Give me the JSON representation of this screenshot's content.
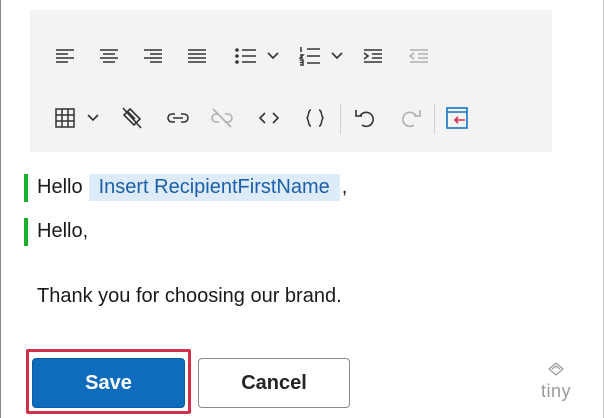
{
  "toolbar": {
    "row1": [
      {
        "icon": "align-left-icon"
      },
      {
        "icon": "align-center-icon"
      },
      {
        "icon": "align-right-icon"
      },
      {
        "icon": "align-justify-icon"
      },
      {
        "icon": "bullet-list-icon"
      },
      {
        "icon": "chevron-down-icon"
      },
      {
        "icon": "numbered-list-icon"
      },
      {
        "icon": "chevron-down-icon"
      },
      {
        "icon": "indent-icon"
      },
      {
        "icon": "outdent-icon"
      }
    ],
    "row2": [
      {
        "icon": "table-icon"
      },
      {
        "icon": "chevron-down-icon"
      },
      {
        "icon": "remove-format-icon"
      },
      {
        "icon": "link-icon"
      },
      {
        "icon": "unlink-icon"
      },
      {
        "icon": "code-icon"
      },
      {
        "icon": "braces-icon"
      },
      {
        "icon": "undo-icon"
      },
      {
        "icon": "redo-icon"
      },
      {
        "icon": "insert-field-icon"
      }
    ]
  },
  "editor": {
    "line1_prefix": "Hello",
    "placeholder_token": "Insert RecipientFirstName",
    "line1_suffix": ",",
    "line2": "Hello,",
    "line3": "Thank you for choosing our brand."
  },
  "actions": {
    "save_label": "Save",
    "cancel_label": "Cancel"
  },
  "branding": {
    "logo_text": "tiny"
  },
  "colors": {
    "primary": "#0f6cbd",
    "highlight_outline": "#d32f4b",
    "change_bar": "#19b32b",
    "placeholder_bg": "#deecf9"
  }
}
